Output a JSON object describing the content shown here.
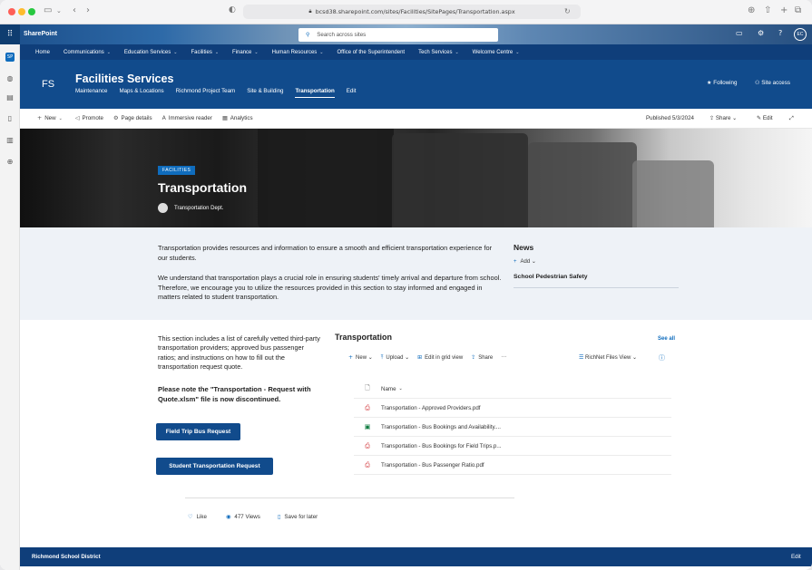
{
  "browser": {
    "url": "bcsd38.sharepoint.com/sites/Facilities/SitePages/Transportation.aspx"
  },
  "suite": {
    "brand": "SharePoint",
    "search_placeholder": "Search across sites",
    "avatar_initials": "EC"
  },
  "global_nav": {
    "items": [
      {
        "label": "Home",
        "dropdown": false
      },
      {
        "label": "Communications",
        "dropdown": true
      },
      {
        "label": "Education Services",
        "dropdown": true
      },
      {
        "label": "Facilities",
        "dropdown": true
      },
      {
        "label": "Finance",
        "dropdown": true
      },
      {
        "label": "Human Resources",
        "dropdown": true
      },
      {
        "label": "Office of the Superintendent",
        "dropdown": false
      },
      {
        "label": "Tech Services",
        "dropdown": true
      },
      {
        "label": "Welcome Centre",
        "dropdown": true
      }
    ]
  },
  "site": {
    "logo": "FS",
    "title": "Facilities Services",
    "nav": [
      "Maintenance",
      "Maps & Locations",
      "Richmond Project Team",
      "Site & Building",
      "Transportation",
      "Edit"
    ],
    "selected_nav": "Transportation",
    "following": "Following",
    "site_access": "Site access"
  },
  "command_bar": {
    "new": "New",
    "promote": "Promote",
    "page_details": "Page details",
    "immersive_reader": "Immersive reader",
    "analytics": "Analytics",
    "published": "Published 5/3/2024",
    "share": "Share",
    "edit": "Edit"
  },
  "hero": {
    "badge": "FACILITIES",
    "title": "Transportation",
    "author": "Transportation Dept."
  },
  "intro": {
    "p1": "Transportation provides resources and information to ensure a smooth and efficient transportation experience for our students.",
    "p2": "We understand that transportation plays a crucial role in ensuring students' timely arrival and departure from school. Therefore, we encourage you to utilize the resources provided in this section to stay informed and engaged in matters related to student transportation."
  },
  "news": {
    "heading": "News",
    "add": "Add",
    "item": "School Pedestrian Safety"
  },
  "lower": {
    "text": "This section includes a list of carefully vetted third-party transportation providers; approved bus passenger ratios; and instructions on how to fill out the transportation request quote.",
    "note": "Please note the \"Transportation - Request with Quote.xlsm\" file is now discontinued.",
    "btn1": "Field Trip Bus Request",
    "btn2": "Student Transportation Request"
  },
  "library": {
    "title": "Transportation",
    "see_all": "See all",
    "cmd": {
      "new": "New",
      "upload": "Upload",
      "grid": "Edit in grid view",
      "share": "Share",
      "more": "···"
    },
    "view": "RichNet Files View",
    "column": "Name",
    "files": [
      {
        "name": "Transportation - Approved Providers.pdf",
        "type": "pdf"
      },
      {
        "name": "Transportation - Bus Bookings and Availability....",
        "type": "xls"
      },
      {
        "name": "Transportation - Bus Bookings for Field Trips.p...",
        "type": "pdf"
      },
      {
        "name": "Transportation - Bus Passenger Ratio.pdf",
        "type": "pdf"
      }
    ]
  },
  "social": {
    "like": "Like",
    "views": "477 Views",
    "save": "Save for later"
  },
  "footer": {
    "title": "Richmond School District",
    "edit": "Edit"
  }
}
